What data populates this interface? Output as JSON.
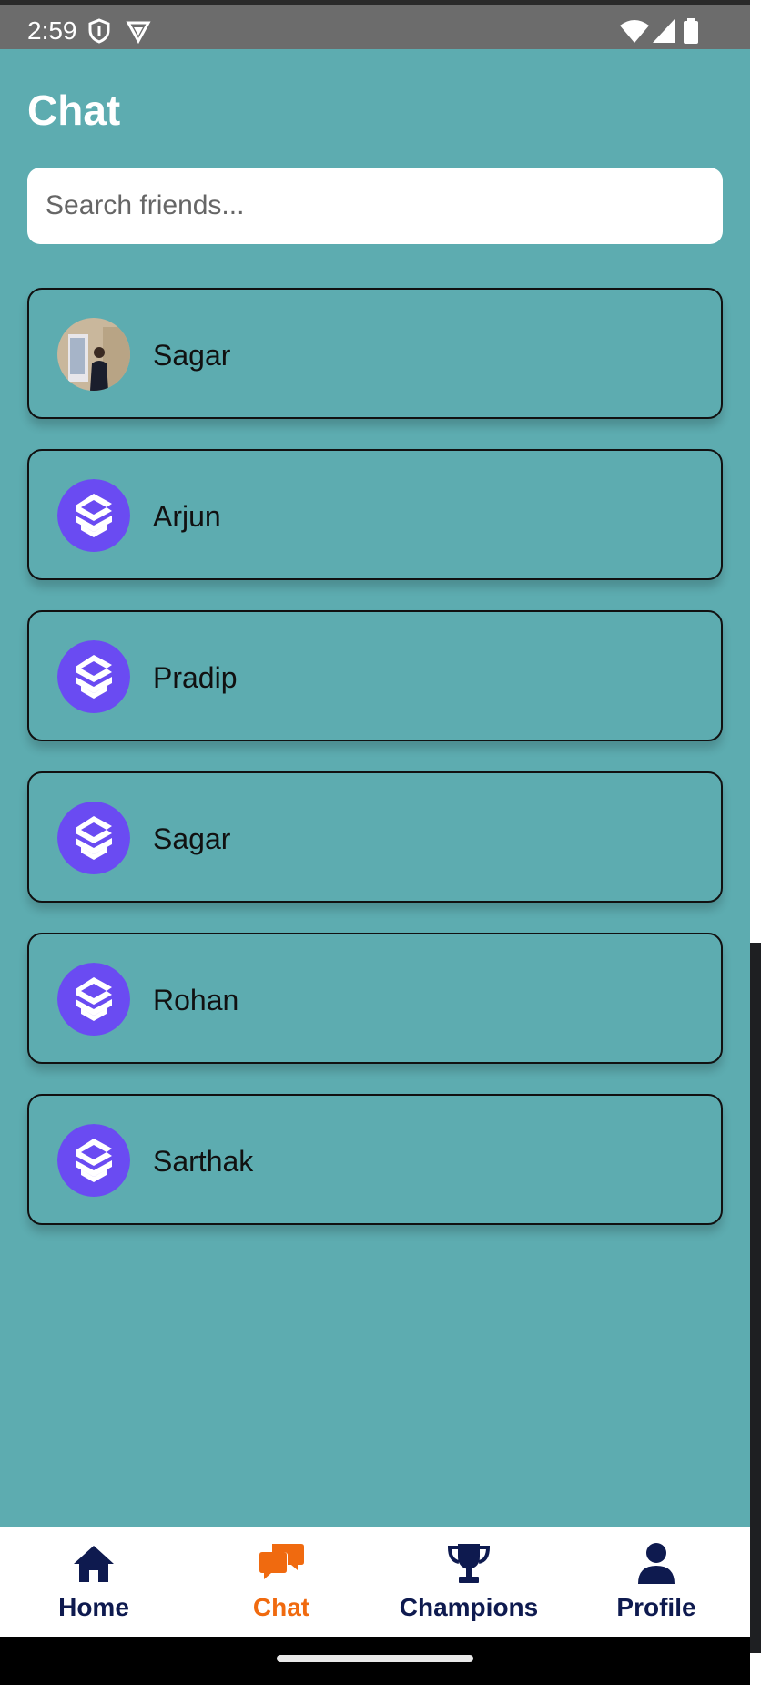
{
  "status_bar": {
    "time": "2:59",
    "icons": [
      "shield-icon",
      "vpn-icon",
      "wifi-icon",
      "signal-icon",
      "battery-icon"
    ]
  },
  "page": {
    "title": "Chat"
  },
  "search": {
    "placeholder": "Search friends..."
  },
  "friends": [
    {
      "name": "Sagar",
      "avatar": "photo-avatar"
    },
    {
      "name": "Arjun",
      "avatar": "app-logo-avatar"
    },
    {
      "name": "Pradip",
      "avatar": "app-logo-avatar"
    },
    {
      "name": "Sagar",
      "avatar": "app-logo-avatar"
    },
    {
      "name": "Rohan",
      "avatar": "app-logo-avatar"
    },
    {
      "name": "Sarthak",
      "avatar": "app-logo-avatar"
    }
  ],
  "bottom_nav": {
    "items": [
      {
        "label": "Home",
        "icon": "home-icon",
        "active": false
      },
      {
        "label": "Chat",
        "icon": "chat-icon",
        "active": true
      },
      {
        "label": "Champions",
        "icon": "trophy-icon",
        "active": false
      },
      {
        "label": "Profile",
        "icon": "person-icon",
        "active": false
      }
    ]
  },
  "colors": {
    "background": "#5dacb0",
    "accent_active": "#f06a0f",
    "nav_inactive": "#0e1a4f",
    "avatar_purple": "#6a4bf2",
    "status_bar": "#6c6c6c"
  }
}
